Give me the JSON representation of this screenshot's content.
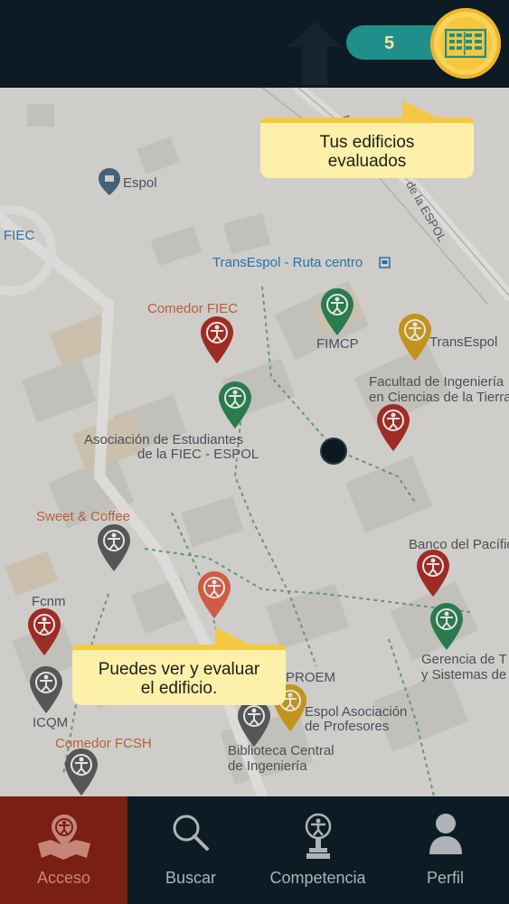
{
  "header": {
    "evaluated_count": "5",
    "badge_icon": "building-list-icon"
  },
  "map": {
    "places": {
      "espol": "Espol",
      "fiec": "FIEC",
      "transespol_ruta": "TransEspol - Ruta centro",
      "comedor_fiec": "Comedor FIEC",
      "fimcp": "FIMCP",
      "transespol": "TransEspol",
      "facultad_line1": "Facultad de Ingeniería",
      "facultad_line2": "en Ciencias de la Tierra",
      "asociacion_line1": "Asociación de Estudiantes",
      "asociacion_line2": "de la FIEC - ESPOL",
      "sweet_coffee": "Sweet & Coffee",
      "banco": "Banco del Pacífico",
      "fcnm": "Fcnm",
      "gerencia_line1": "Gerencia de T",
      "gerencia_line2": "y Sistemas de",
      "proem": "PROEM",
      "espol_asoc_line1": "Espol Asociación",
      "espol_asoc_line2": "de Profesores",
      "icqm": "ICQM",
      "comedor_fcsh": "Comedor FCSH",
      "biblioteca_line1": "Biblioteca Central",
      "biblioteca_line2": "de Ingeniería",
      "road1": "Avenida",
      "road2": "de la ESPOL"
    }
  },
  "tooltips": {
    "evaluated_line1": "Tus edificios",
    "evaluated_line2": "evaluados",
    "building_line1": "Puedes ver y evaluar",
    "building_line2": "el edificio."
  },
  "nav": {
    "items": [
      {
        "label": "Acceso",
        "icon": "accessibility-map-icon"
      },
      {
        "label": "Buscar",
        "icon": "search-icon"
      },
      {
        "label": "Competencia",
        "icon": "trophy-icon"
      },
      {
        "label": "Perfil",
        "icon": "user-icon"
      }
    ]
  },
  "colors": {
    "pin_red": "#b0322a",
    "pin_green": "#2f8a57",
    "pin_yellow": "#d9a520",
    "pin_gray": "#5f6062",
    "pin_selected": "#e8674e",
    "accent_teal": "#1f8f8b",
    "tooltip_bg": "#fdf0a8"
  }
}
